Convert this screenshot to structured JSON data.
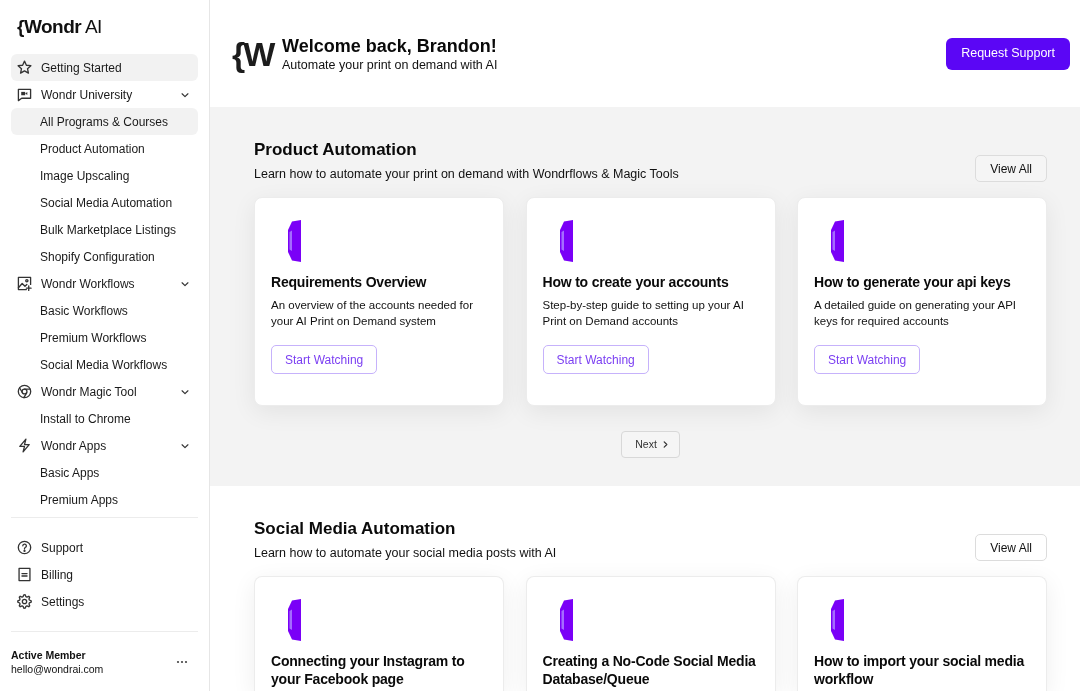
{
  "sidebar": {
    "logo": "**{Wondr** AI",
    "nav": [
      {
        "label": "Getting Started",
        "selected": true
      },
      {
        "label": "Wondr University",
        "selected": false,
        "expanded": true,
        "children": [
          {
            "label": "All Programs & Courses",
            "selected": true
          },
          {
            "label": "Product Automation",
            "selected": false
          },
          {
            "label": "Image Upscaling",
            "selected": false
          },
          {
            "label": "Social Media Automation",
            "selected": false
          },
          {
            "label": "Bulk Marketplace Listings",
            "selected": false
          },
          {
            "label": "Shopify Configuration",
            "selected": false
          }
        ]
      },
      {
        "label": "Wondr Workflows",
        "selected": false,
        "expanded": true,
        "children": [
          {
            "label": "Basic Workflows",
            "selected": false
          },
          {
            "label": "Premium Workflows",
            "selected": false
          },
          {
            "label": "Social Media Workflows",
            "selected": false
          }
        ]
      },
      {
        "label": "Wondr Magic Tool",
        "selected": false,
        "expanded": true,
        "children": [
          {
            "label": "Install to Chrome",
            "selected": false
          }
        ]
      },
      {
        "label": "Wondr Apps",
        "selected": false,
        "expanded": true,
        "children": [
          {
            "label": "Basic Apps",
            "selected": false
          },
          {
            "label": "Premium Apps",
            "selected": false
          }
        ]
      }
    ],
    "secondary_nav": [
      {
        "label": "Support",
        "selected": false
      },
      {
        "label": "Billing",
        "selected": false
      },
      {
        "label": "Settings",
        "selected": false
      }
    ],
    "account": {
      "status": "Active Member",
      "email": "hello@wondrai.com"
    }
  },
  "header": {
    "logo_mark": "{W",
    "title": "Welcome back, Brandon!",
    "subtitle": "Automate your print on demand with AI",
    "button": "Request Support"
  },
  "sections": [
    {
      "title": "Product Automation",
      "description": "Learn how to automate your print on demand with Wondrflows & Magic Tools",
      "view_all": "View All",
      "cards": [
        {
          "title": "Requirements Overview",
          "description": "An overview of the accounts needed for your AI Print on Demand system",
          "button": "Start Watching"
        },
        {
          "title": "How to create your accounts",
          "description": "Step-by-step guide to setting up your AI Print on Demand accounts",
          "button": "Start Watching"
        },
        {
          "title": "How to generate your api keys",
          "description": "A detailed guide on generating your API keys for required accounts",
          "button": "Start Watching"
        }
      ],
      "pager": "Next"
    },
    {
      "title": "Social Media Automation",
      "description": "Learn how to automate your social media posts with AI",
      "view_all": "View All",
      "cards": [
        {
          "title": "Connecting your Instagram to your Facebook page"
        },
        {
          "title": "Creating a No-Code Social Media Database/Queue"
        },
        {
          "title": "How to import your social media workflow"
        }
      ]
    }
  ]
}
